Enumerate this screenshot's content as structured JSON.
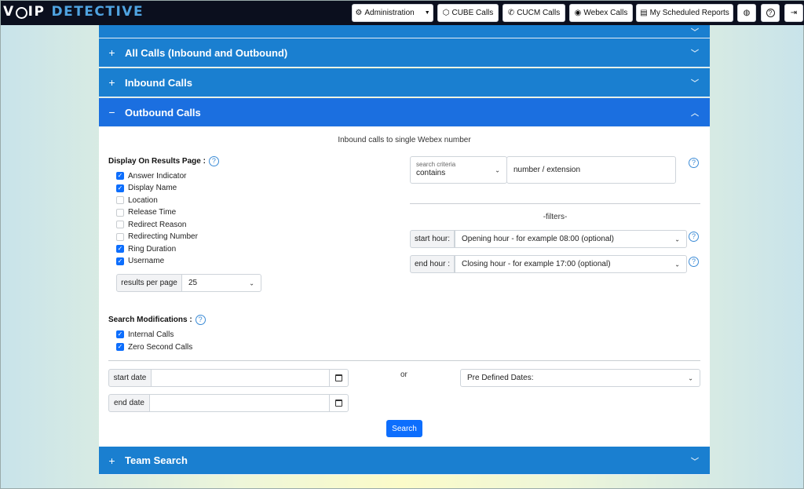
{
  "header": {
    "logo_voip_a": "V",
    "logo_voip_b": "IP",
    "logo_detective": "DETECTIVE",
    "nav": {
      "administration": "Administration",
      "cube_calls": "CUBE Calls",
      "cucm_calls": "CUCM Calls",
      "webex_calls": "Webex Calls",
      "scheduled_reports": "My Scheduled Reports"
    },
    "icons": {
      "administration": "gear-icon",
      "cube": "cube-icon",
      "cucm": "phone-icon",
      "webex": "webex-icon",
      "reports": "report-icon",
      "profile": "user-circle-icon",
      "help": "help-circle-icon",
      "logout": "logout-icon"
    }
  },
  "accordion": {
    "all_calls": "All Calls (Inbound and Outbound)",
    "inbound": "Inbound Calls",
    "outbound": "Outbound Calls",
    "team_search": "Team Search",
    "plus": "+",
    "minus": "−"
  },
  "panel": {
    "note": "Inbound calls to single Webex number",
    "display_title": "Display On Results Page :",
    "display_options": [
      {
        "label": "Answer Indicator",
        "checked": true
      },
      {
        "label": "Display Name",
        "checked": true
      },
      {
        "label": "Location",
        "checked": false
      },
      {
        "label": "Release Time",
        "checked": false
      },
      {
        "label": "Redirect Reason",
        "checked": false
      },
      {
        "label": "Redirecting Number",
        "checked": false
      },
      {
        "label": "Ring Duration",
        "checked": true
      },
      {
        "label": "Username",
        "checked": true
      }
    ],
    "results_per_page_label": "results per page",
    "results_per_page_value": "25",
    "modifications_title": "Search Modifications :",
    "modifications": [
      {
        "label": "Internal Calls",
        "checked": true
      },
      {
        "label": "Zero Second Calls",
        "checked": true
      }
    ],
    "search_criteria_label": "search criteria",
    "search_criteria_value": "contains",
    "number_placeholder": "number / extension",
    "filters_label": "-filters-",
    "start_hour_label": "start hour:",
    "start_hour_value": "Opening hour - for example 08:00 (optional)",
    "end_hour_label": "end hour :",
    "end_hour_value": "Closing hour - for example 17:00 (optional)",
    "start_date_label": "start date",
    "end_date_label": "end date",
    "or_label": "or",
    "predefined_dates": "Pre Defined Dates:",
    "search_button": "Search",
    "help_glyph": "?"
  },
  "colors": {
    "accordion": "#1a7fd0",
    "accordion_active": "#1b6fe0",
    "primary": "#0d6efd",
    "topbar": "#0b0f1e"
  }
}
